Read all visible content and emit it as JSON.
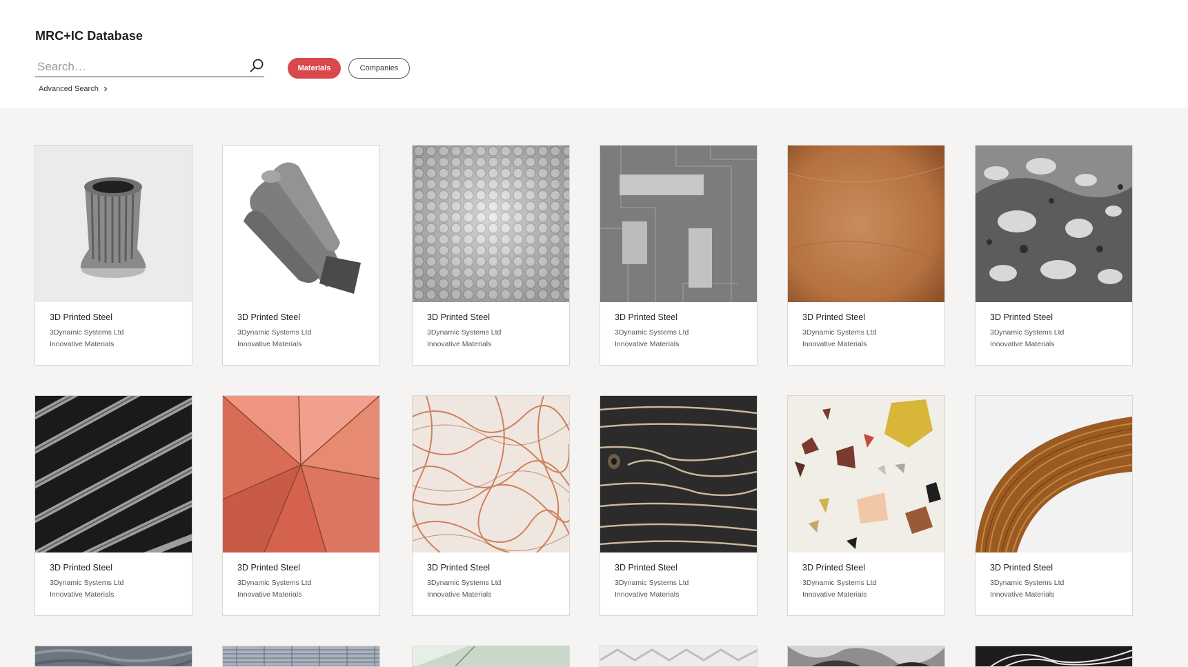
{
  "header": {
    "title": "MRC+IC Database",
    "search_placeholder": "Search…",
    "search_value": "",
    "search_icon": "search-icon",
    "advanced_search_label": "Advanced Search",
    "filters": [
      {
        "label": "Materials",
        "active": true
      },
      {
        "label": "Companies",
        "active": false
      }
    ]
  },
  "colors": {
    "accent": "#d9484a",
    "header_bg": "#ffffff",
    "page_bg": "#f5f4f2"
  },
  "cards": [
    {
      "name": "3D Printed Steel",
      "company": "3Dynamic Systems Ltd",
      "category": "Innovative Materials",
      "image": "steel-turbine-part"
    },
    {
      "name": "3D Printed Steel",
      "company": "3Dynamic Systems Ltd",
      "category": "Innovative Materials",
      "image": "steel-manifold-pipe"
    },
    {
      "name": "3D Printed Steel",
      "company": "3Dynamic Systems Ltd",
      "category": "Innovative Materials",
      "image": "hexagon-mesh"
    },
    {
      "name": "3D Printed Steel",
      "company": "3Dynamic Systems Ltd",
      "category": "Innovative Materials",
      "image": "circuit-blocks"
    },
    {
      "name": "3D Printed Steel",
      "company": "3Dynamic Systems Ltd",
      "category": "Innovative Materials",
      "image": "copper-texture"
    },
    {
      "name": "3D Printed Steel",
      "company": "3Dynamic Systems Ltd",
      "category": "Innovative Materials",
      "image": "liquid-metal"
    },
    {
      "name": "3D Printed Steel",
      "company": "3Dynamic Systems Ltd",
      "category": "Innovative Materials",
      "image": "ribbed-tubes"
    },
    {
      "name": "3D Printed Steel",
      "company": "3Dynamic Systems Ltd",
      "category": "Innovative Materials",
      "image": "coral-facets"
    },
    {
      "name": "3D Printed Steel",
      "company": "3Dynamic Systems Ltd",
      "category": "Innovative Materials",
      "image": "copper-wire-fabric"
    },
    {
      "name": "3D Printed Steel",
      "company": "3Dynamic Systems Ltd",
      "category": "Innovative Materials",
      "image": "charred-wood"
    },
    {
      "name": "3D Printed Steel",
      "company": "3Dynamic Systems Ltd",
      "category": "Innovative Materials",
      "image": "terrazzo"
    },
    {
      "name": "3D Printed Steel",
      "company": "3Dynamic Systems Ltd",
      "category": "Innovative Materials",
      "image": "bent-wood"
    }
  ],
  "partial_row_images": [
    "grey-textile",
    "blue-weave",
    "green-glass",
    "folded-paper",
    "chrome-folds",
    "woven-white"
  ]
}
